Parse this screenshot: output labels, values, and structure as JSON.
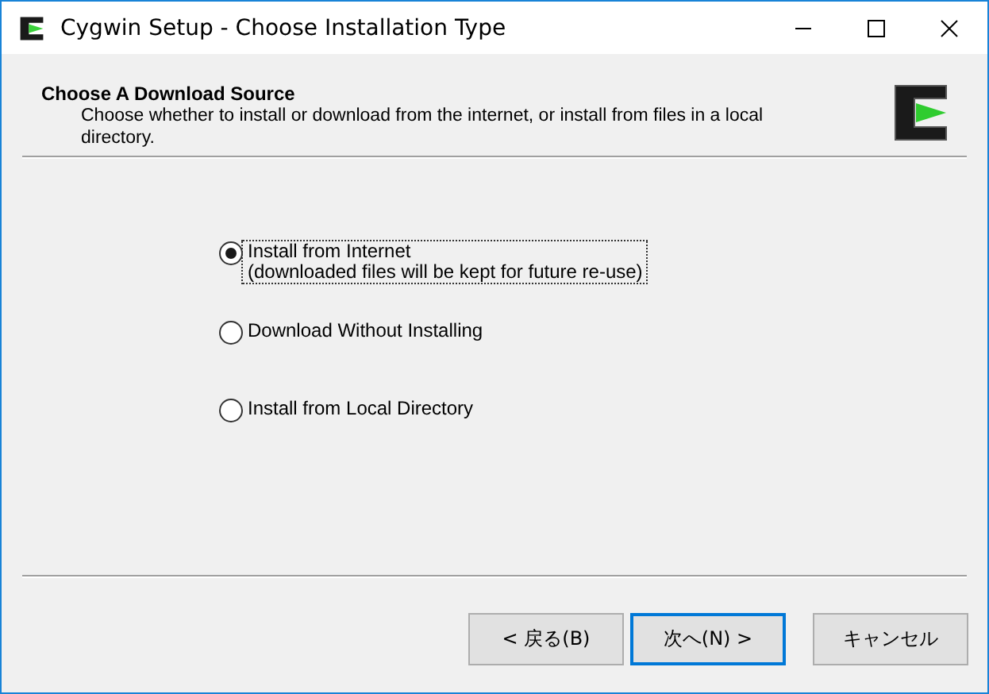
{
  "window": {
    "title": "Cygwin Setup - Choose Installation Type"
  },
  "header": {
    "title": "Choose A Download Source",
    "description": "Choose whether to install or download from the internet, or install from files in a local directory."
  },
  "options": [
    {
      "label": "Install from Internet",
      "note": "(downloaded files will be kept for future re-use)",
      "selected": true
    },
    {
      "label": "Download Without Installing",
      "selected": false
    },
    {
      "label": "Install from Local Directory",
      "selected": false
    }
  ],
  "buttons": [
    {
      "label": "< 戻る(B)",
      "focused": false
    },
    {
      "label": "次へ(N) >",
      "focused": true
    },
    {
      "label": "キャンセル",
      "focused": false
    }
  ]
}
